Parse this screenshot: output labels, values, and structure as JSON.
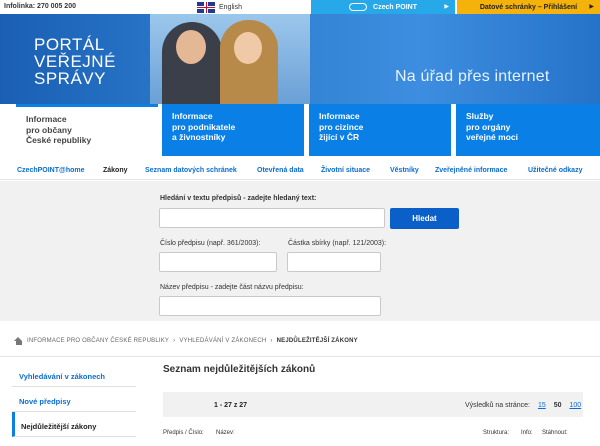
{
  "topbar": {
    "infolinka": "Infolinka: 270 005 200",
    "language": "English",
    "czechpoint_tab": "Czech POINT",
    "datove_tab": "Datové schránky – Přihlášení"
  },
  "banner": {
    "portal_title": [
      "PORTÁL",
      "VEŘEJNÉ",
      "SPRÁVY"
    ],
    "slogan": "Na úřad přes internet"
  },
  "tabs": [
    {
      "lines": [
        "Informace",
        "pro občany",
        "České republiky"
      ]
    },
    {
      "lines": [
        "Informace",
        "pro podnikatele",
        "a živnostníky"
      ]
    },
    {
      "lines": [
        "Informace",
        "pro cizince",
        "žijící v ČR"
      ]
    },
    {
      "lines": [
        "Služby",
        "pro orgány",
        "veřejné moci"
      ]
    }
  ],
  "subnav": [
    "CzechPOINT@home",
    "Zákony",
    "Seznam datových schránek",
    "Otevřená data",
    "Životní situace",
    "Věstníky",
    "Zveřejněné informace",
    "Užitečné odkazy"
  ],
  "search": {
    "fulltext_label": "Hledání v textu předpisů - zadejte hledaný text:",
    "search_button": "Hledat",
    "cislo_label": "Číslo předpisu (např. 361/2003):",
    "castka_label": "Částka sbírky (např. 121/2003):",
    "nazev_label": "Název předpisu - zadejte část názvu předpisu:"
  },
  "breadcrumb": {
    "items": [
      "INFORMACE PRO OBČANY ČESKÉ REPUBLIKY",
      "VYHLEDÁVÁNÍ V ZÁKONECH",
      "NEJDŮLEŽITĚJŠÍ ZÁKONY"
    ],
    "separator": "›"
  },
  "leftmenu": [
    "Vyhledávání v zákonech",
    "Nové předpisy",
    "Nejdůležitější zákony"
  ],
  "main": {
    "title": "Seznam nejdůležitějších zákonů",
    "pager": "1 - 27 z 27",
    "per_page_label": "Výsledků na stránce:",
    "per_page_options": [
      "15",
      "50",
      "100"
    ],
    "table_headers": [
      "Předpis / Číslo:",
      "Název:",
      "Struktura:",
      "Info:",
      "Stáhnout:"
    ]
  },
  "colors": {
    "accent_blue": "#0a7fe6",
    "czechpoint": "#27a8e8",
    "datove": "#f5b20a"
  }
}
